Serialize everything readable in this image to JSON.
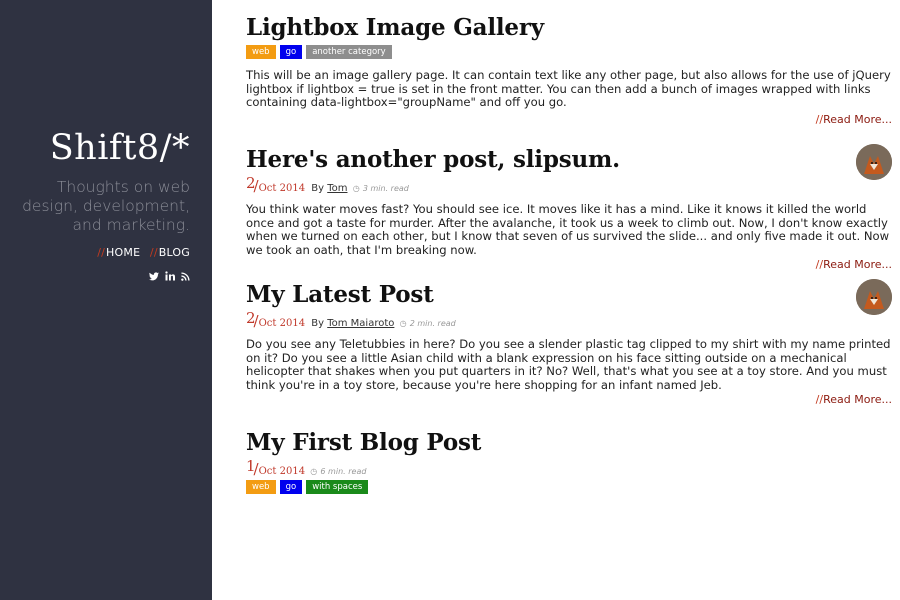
{
  "sidebar": {
    "brand": "Shift8/*",
    "tagline": "Thoughts on web design, development, and marketing.",
    "nav": [
      {
        "slashes": "//",
        "label": "HOME"
      },
      {
        "slashes": "//",
        "label": "BLOG"
      }
    ],
    "social": [
      "twitter-icon",
      "linkedin-icon",
      "rss-icon"
    ]
  },
  "colors": {
    "sidebar_bg": "#2f3241",
    "accent": "#c0392b",
    "tag_orange": "#f39c12",
    "tag_blue": "#0000ee",
    "tag_gray": "#8e8e8e",
    "tag_green": "#1a8a1a"
  },
  "posts": [
    {
      "title": "Lightbox Image Gallery",
      "tags": [
        "web",
        "go",
        "another category"
      ],
      "excerpt": "This will be an image gallery page. It can contain text like any other page, but also allows for the use of jQuery lightbox if lightbox = true is set in the front matter. You can then add a bunch of images wrapped with links containing data-lightbox=\"groupName\" and off you go.",
      "readmore_slashes": "//",
      "readmore": "Read More..."
    },
    {
      "title": "Here's another post, slipsum.",
      "day": "2",
      "slash": "/",
      "monthyear": "Oct 2014",
      "by": "By",
      "author": "Tom",
      "readtime": "3 min. read",
      "excerpt": "You think water moves fast? You should see ice. It moves like it has a mind. Like it knows it killed the world once and got a taste for murder. After the avalanche, it took us a week to climb out. Now, I don't know exactly when we turned on each other, but I know that seven of us survived the slide... and only five made it out. Now we took an oath, that I'm breaking now.",
      "readmore_slashes": "//",
      "readmore": "Read More..."
    },
    {
      "title": "My Latest Post",
      "day": "2",
      "slash": "/",
      "monthyear": "Oct 2014",
      "by": "By",
      "author": "Tom Maiaroto",
      "readtime": "2 min. read",
      "excerpt": "Do you see any Teletubbies in here? Do you see a slender plastic tag clipped to my shirt with my name printed on it? Do you see a little Asian child with a blank expression on his face sitting outside on a mechanical helicopter that shakes when you put quarters in it? No? Well, that's what you see at a toy store. And you must think you're in a toy store, because you're here shopping for an infant named Jeb.",
      "readmore_slashes": "//",
      "readmore": "Read More..."
    },
    {
      "title": "My First Blog Post",
      "day": "1",
      "slash": "/",
      "monthyear": "Oct 2014",
      "readtime": "6 min. read",
      "tags": [
        "web",
        "go",
        "with spaces"
      ]
    }
  ]
}
